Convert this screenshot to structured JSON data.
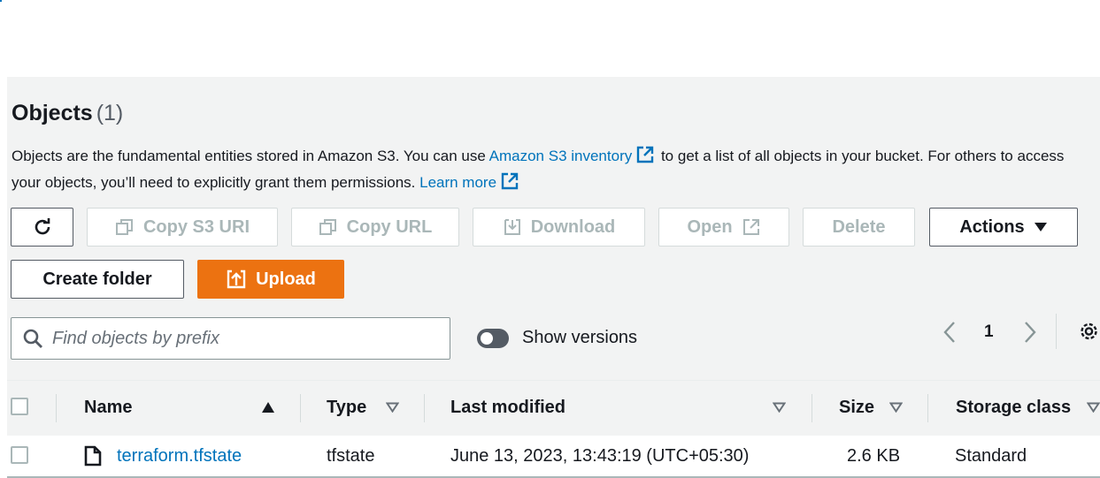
{
  "header": {
    "title": "Objects",
    "count": "(1)"
  },
  "description": {
    "part1": "Objects are the fundamental entities stored in Amazon S3. You can use ",
    "link1": "Amazon S3 inventory",
    "part2": " to get a list of all objects in your bucket. For others to access your objects, you’ll need to explicitly grant them permissions. ",
    "link2": "Learn more"
  },
  "toolbar": {
    "copy_s3_uri": "Copy S3 URI",
    "copy_url": "Copy URL",
    "download": "Download",
    "open": "Open",
    "delete": "Delete",
    "actions": "Actions",
    "create_folder": "Create folder",
    "upload": "Upload"
  },
  "search": {
    "placeholder": "Find objects by prefix",
    "value": ""
  },
  "versions_toggle": {
    "label": "Show versions",
    "checked": false
  },
  "pagination": {
    "current_page": "1"
  },
  "table": {
    "columns": {
      "name": "Name",
      "type": "Type",
      "last_modified": "Last modified",
      "size": "Size",
      "storage_class": "Storage class"
    },
    "rows": [
      {
        "name": "terraform.tfstate",
        "type": "tfstate",
        "last_modified": "June 13, 2023, 13:43:19 (UTC+05:30)",
        "size": "2.6 KB",
        "storage_class": "Standard"
      }
    ]
  },
  "colors": {
    "accent": "#ec7211",
    "link": "#0073bb",
    "text": "#16191f",
    "disabled": "#aab7b8",
    "panel_bg": "#f2f3f3"
  },
  "icons": [
    "refresh-icon",
    "copy-icon",
    "download-icon",
    "external-link-icon",
    "caret-down-icon",
    "upload-icon",
    "search-icon",
    "chevron-left-icon",
    "chevron-right-icon",
    "gear-icon",
    "sort-ascending-icon",
    "sort-icon",
    "file-icon"
  ]
}
